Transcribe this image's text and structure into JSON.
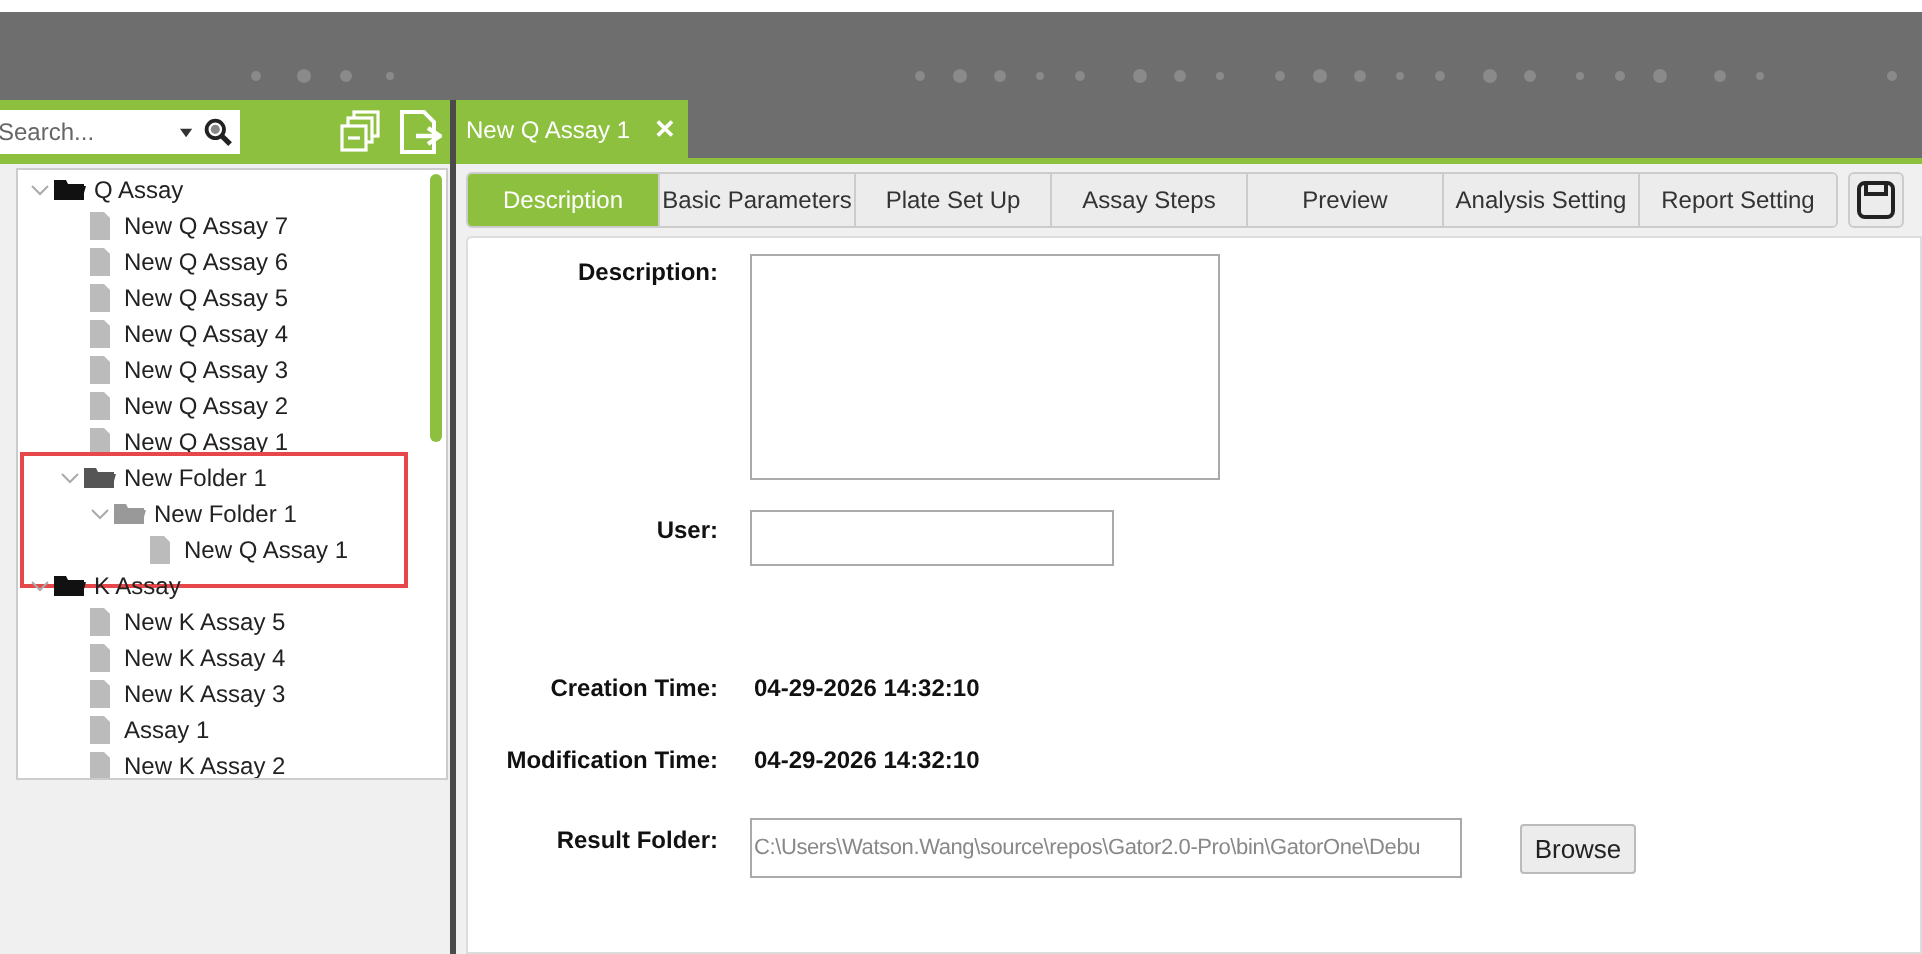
{
  "sidebar": {
    "search": {
      "placeholder": "Search..."
    },
    "tree": [
      {
        "label": "Q Assay",
        "kind": "folder",
        "expanded": true,
        "highlighted": false,
        "children": [
          {
            "label": "New Q Assay 7",
            "kind": "file",
            "highlighted": false
          },
          {
            "label": "New Q Assay 6",
            "kind": "file",
            "highlighted": false
          },
          {
            "label": "New Q Assay 5",
            "kind": "file",
            "highlighted": false
          },
          {
            "label": "New Q Assay 4",
            "kind": "file",
            "highlighted": false
          },
          {
            "label": "New Q Assay 3",
            "kind": "file",
            "highlighted": false
          },
          {
            "label": "New Q Assay 2",
            "kind": "file",
            "highlighted": false
          },
          {
            "label": "New Q Assay 1",
            "kind": "file",
            "highlighted": false
          },
          {
            "label": "New Folder 1",
            "kind": "folder",
            "expanded": true,
            "highlighted": true,
            "children": [
              {
                "label": "New Folder 1",
                "kind": "folder",
                "expanded": true,
                "highlighted": false,
                "children": [
                  {
                    "label": "New Q Assay 1",
                    "kind": "file",
                    "highlighted": false
                  }
                ]
              }
            ]
          }
        ]
      },
      {
        "label": "K Assay",
        "kind": "folder",
        "expanded": true,
        "highlighted": false,
        "children": [
          {
            "label": "New K Assay 5",
            "kind": "file",
            "highlighted": false
          },
          {
            "label": "New K Assay 4",
            "kind": "file",
            "highlighted": false
          },
          {
            "label": "New K Assay 3",
            "kind": "file",
            "highlighted": false
          },
          {
            "label": "Assay 1",
            "kind": "file",
            "highlighted": false
          },
          {
            "label": "New K Assay 2",
            "kind": "file",
            "highlighted": false
          }
        ]
      }
    ]
  },
  "tabs": [
    {
      "label": "New Q Assay 1",
      "close": "✕",
      "selected": true
    }
  ],
  "sub_tabs": [
    {
      "label": "Description",
      "selected": true
    },
    {
      "label": "Basic Parameters",
      "selected": false
    },
    {
      "label": "Plate Set Up",
      "selected": false
    },
    {
      "label": "Assay Steps",
      "selected": false
    },
    {
      "label": "Preview",
      "selected": false
    },
    {
      "label": "Analysis Setting",
      "selected": false
    },
    {
      "label": "Report Setting",
      "selected": false
    }
  ],
  "form": [
    {
      "kind": "textarea",
      "label": "Description:"
    },
    {
      "kind": "input",
      "label": "User:"
    },
    {
      "kind": "text",
      "label": "Creation Time:",
      "value": "04-29-2026 14:32:10"
    },
    {
      "kind": "text",
      "label": "Modification Time:",
      "value": "04-29-2026 14:32:10"
    },
    {
      "kind": "path",
      "label": "Result Folder:",
      "value": "C:\\Users\\Watson.Wang\\source\\repos\\Gator2.0-Pro\\bin\\GatorOne\\Debu",
      "button": "Browse"
    }
  ]
}
